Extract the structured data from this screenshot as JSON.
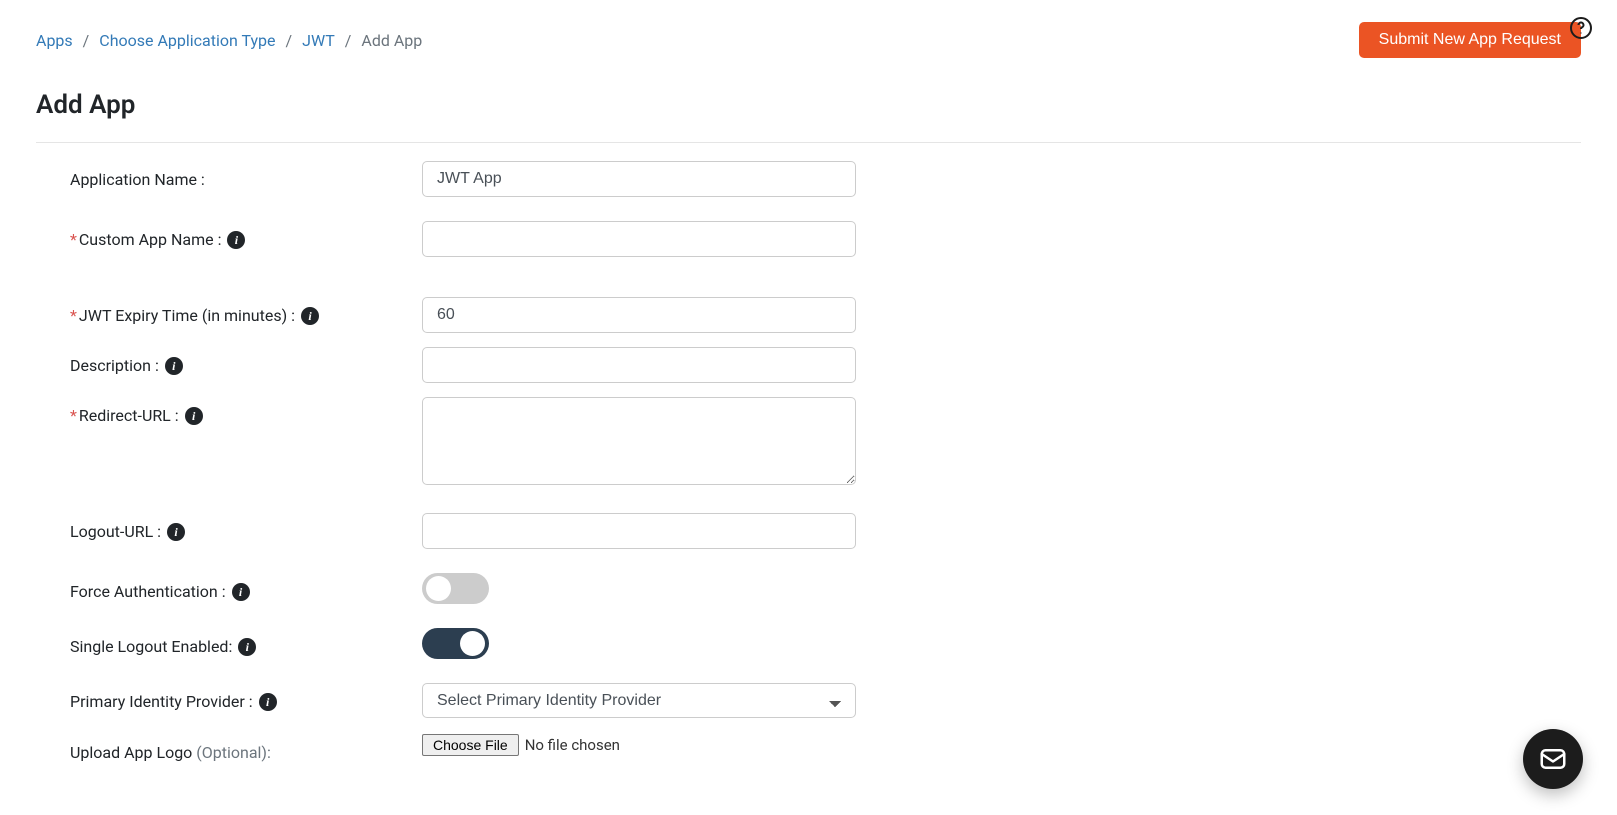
{
  "breadcrumb": {
    "items": [
      "Apps",
      "Choose Application Type",
      "JWT"
    ],
    "current": "Add App"
  },
  "header_button": "Submit New App Request",
  "page_title": "Add App",
  "form": {
    "application_name": {
      "label": "Application Name :",
      "value": "JWT App"
    },
    "custom_app_name": {
      "label": "Custom App Name :",
      "value": ""
    },
    "jwt_expiry": {
      "label": "JWT Expiry Time (in minutes) :",
      "value": "60"
    },
    "description": {
      "label": "Description :",
      "value": ""
    },
    "redirect_url": {
      "label": "Redirect-URL :",
      "value": ""
    },
    "logout_url": {
      "label": "Logout-URL :",
      "value": ""
    },
    "force_auth": {
      "label": "Force Authentication :",
      "on": false
    },
    "single_logout": {
      "label": "Single Logout Enabled:",
      "on": true
    },
    "primary_idp": {
      "label": "Primary Identity Provider :",
      "placeholder": "Select Primary Identity Provider"
    },
    "upload_logo": {
      "label": "Upload App Logo ",
      "optional": "(Optional):",
      "button": "Choose File",
      "status": "No file chosen"
    }
  }
}
